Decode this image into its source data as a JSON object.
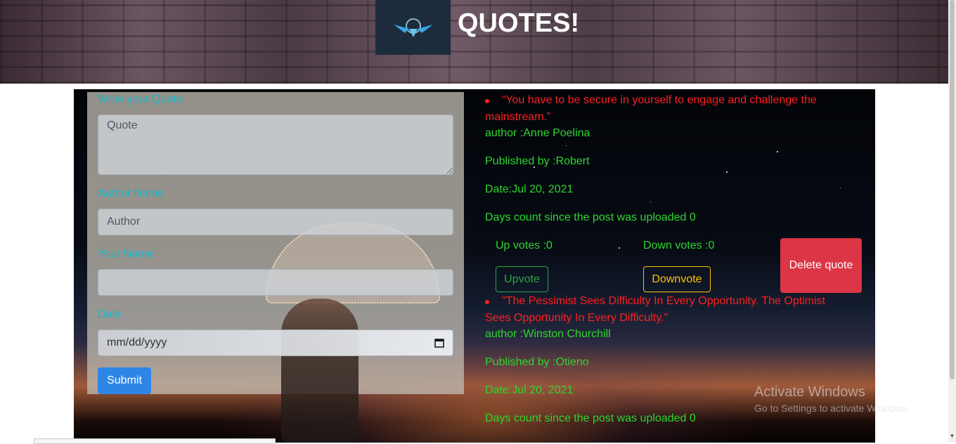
{
  "header": {
    "title": "QUOTES!"
  },
  "form": {
    "quote_label": "Write your Quote",
    "quote_placeholder": "Quote",
    "author_label": "Author Name",
    "author_placeholder": "Author",
    "name_label": "Your Name",
    "name_value": "",
    "date_label": "Date",
    "date_placeholder": "mm/dd/yyyy",
    "submit_label": "Submit"
  },
  "quotes": [
    {
      "text": "“You have to be secure in yourself to engage and challenge the mainstream.”",
      "author": "author :Anne Poelina",
      "published_by": "Published by :Robert",
      "date": "Date:Jul 20, 2021",
      "days_count": "Days count since the post was uploaded 0",
      "up_votes": "Up votes :0",
      "down_votes": "Down votes :0",
      "upvote_label": "Upvote",
      "downvote_label": "Downvote",
      "delete_label": "Delete quote"
    },
    {
      "text": "\"The Pessimist Sees Difficulty In Every Opportunity. The Optimist Sees Opportunity In Every Difficulty.\"",
      "author": "author :Winston Churchill",
      "published_by": "Published by :Otieno",
      "date": "Date:Jul 20, 2021",
      "days_count": "Days count since the post was uploaded 0"
    }
  ],
  "watermark": {
    "title": "Activate Windows",
    "subtitle": "Go to Settings to activate Windows."
  },
  "colors": {
    "label": "#17b8c8",
    "quote_text": "#ff2020",
    "info_text": "#2fd52f",
    "submit": "#2d86e6",
    "delete": "#dc3545",
    "upvote": "#28a745",
    "downvote": "#ffc107"
  },
  "icons": {
    "logo": "winged-emblem-icon",
    "date_picker": "calendar-icon"
  }
}
